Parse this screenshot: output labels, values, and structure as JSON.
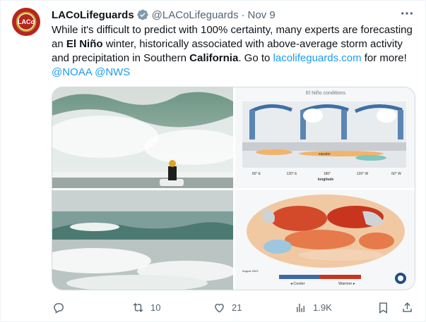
{
  "tweet": {
    "author_name": "LACoLifeguards",
    "handle": "@LACoLifeguards",
    "separator": "·",
    "date": "Nov 9",
    "avatar_text": "LACo",
    "text_parts": [
      {
        "t": "While it's difficult to predict with 100% certainty, many experts are forecasting an ",
        "style": "normal"
      },
      {
        "t": "El Niño",
        "style": "bold"
      },
      {
        "t": " winter, historically associated with above-average storm activity and precipitation in Southern ",
        "style": "normal"
      },
      {
        "t": "California",
        "style": "bold"
      },
      {
        "t": ". Go to ",
        "style": "normal"
      },
      {
        "t": "lacolifeguards.com",
        "style": "link"
      },
      {
        "t": " for more! ",
        "style": "normal"
      },
      {
        "t": "@NOAA",
        "style": "link"
      },
      {
        "t": " ",
        "style": "normal"
      },
      {
        "t": "@NWS",
        "style": "link"
      }
    ]
  },
  "media": {
    "diagram_title": "El Niño conditions",
    "diagram_equator": "equator",
    "diagram_ticks": [
      "60° E",
      "120° E",
      "180°",
      "120° W",
      "60° W"
    ],
    "diagram_axis": "longitude",
    "map_date": "August 2023",
    "map_legend_cool": "◂ Cooler",
    "map_legend_warm": "Warmer ▸"
  },
  "actions": {
    "reply_count": "",
    "retweet_count": "10",
    "like_count": "21",
    "views_count": "1.9K"
  },
  "colors": {
    "link": "#1d9bf0",
    "muted": "#536471",
    "text": "#0f1419",
    "verified": "#829aab"
  },
  "icons": [
    "verified-badge-icon",
    "more-icon",
    "reply-icon",
    "retweet-icon",
    "like-icon",
    "views-icon",
    "bookmark-icon",
    "share-icon"
  ]
}
